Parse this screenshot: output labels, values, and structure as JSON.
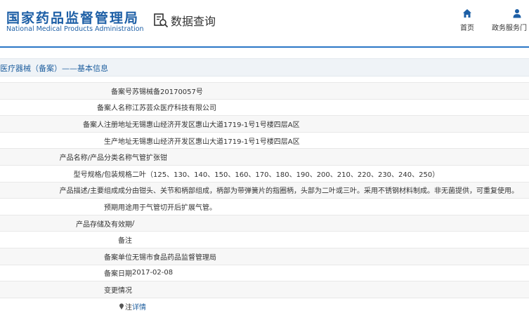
{
  "header": {
    "org_name_cn": "国家药品监督管理局",
    "org_name_en": "National Medical Products Administration",
    "query_label": "数据查询",
    "query_icon": "data-search-icon",
    "nav": [
      {
        "label": "首页",
        "icon": "home-icon"
      },
      {
        "label": "政务服务门",
        "icon": "user-icon"
      }
    ],
    "accent_color": "#1d5fa6"
  },
  "breadcrumb": "医疗器械（备案）——基本信息",
  "rows": [
    {
      "label": "备案号",
      "value": "苏锡械备20170057号"
    },
    {
      "label": "备案人名称",
      "value": "江苏芸众医疗科技有限公司"
    },
    {
      "label": "备案人注册地址",
      "value": "无锡惠山经济开发区惠山大道1719-1号1号楼四层A区"
    },
    {
      "label": "生产地址",
      "value": "无锡惠山经济开发区惠山大道1719-1号1号楼四层A区"
    },
    {
      "label": "产品名称/产品分类名称",
      "value": "气管扩张钳"
    },
    {
      "label": "型号规格/包装规格",
      "value": "二叶（125、130、140、150、160、170、180、190、200、210、220、230、240、250）"
    },
    {
      "label": "产品描述/主要组成成分",
      "value": "由钳头、关节和柄部组成，柄部为带弹簧片的指圈柄，头部为二叶或三叶。采用不锈钢材料制成。非无菌提供，可重复使用。"
    },
    {
      "label": "预期用途",
      "value": "用于气管切开后扩展气管。"
    },
    {
      "label": "产品存储及有效期",
      "value": "/"
    },
    {
      "label": "备注",
      "value": ""
    },
    {
      "label": "备案单位",
      "value": "无锡市食品药品监督管理局"
    },
    {
      "label": "备案日期",
      "value": "2017-02-08"
    },
    {
      "label": "变更情况",
      "value": ""
    },
    {
      "label": "注",
      "value": "详情",
      "icon": "pin-icon",
      "link": true
    }
  ]
}
